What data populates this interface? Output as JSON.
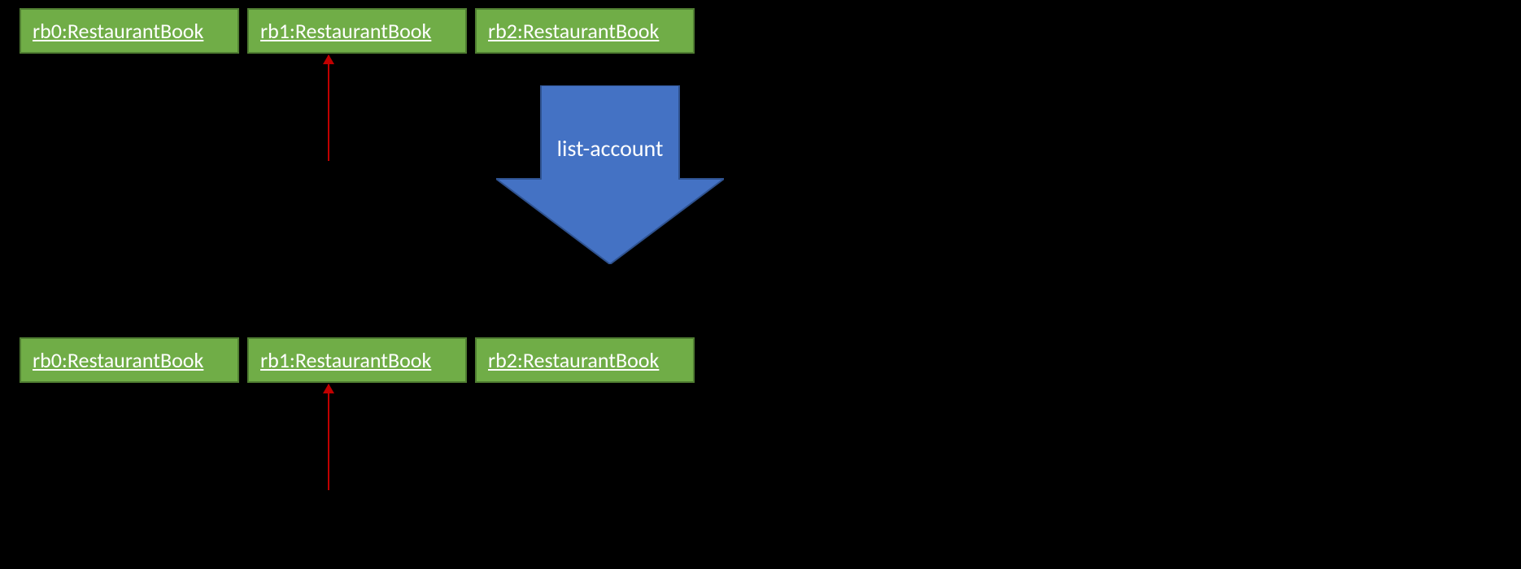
{
  "top_row": {
    "boxes": [
      {
        "label": "rb0:RestaurantBook"
      },
      {
        "label": "rb1:RestaurantBook"
      },
      {
        "label": "rb2:RestaurantBook"
      }
    ]
  },
  "bottom_row": {
    "boxes": [
      {
        "label": "rb0:RestaurantBook"
      },
      {
        "label": "rb1:RestaurantBook"
      },
      {
        "label": "rb2:RestaurantBook"
      }
    ]
  },
  "arrow_label": "list-account",
  "colors": {
    "box_fill": "#70ad47",
    "box_border": "#507e32",
    "big_arrow": "#4472c4",
    "big_arrow_border": "#2f528f",
    "thin_arrow": "#c00000"
  }
}
